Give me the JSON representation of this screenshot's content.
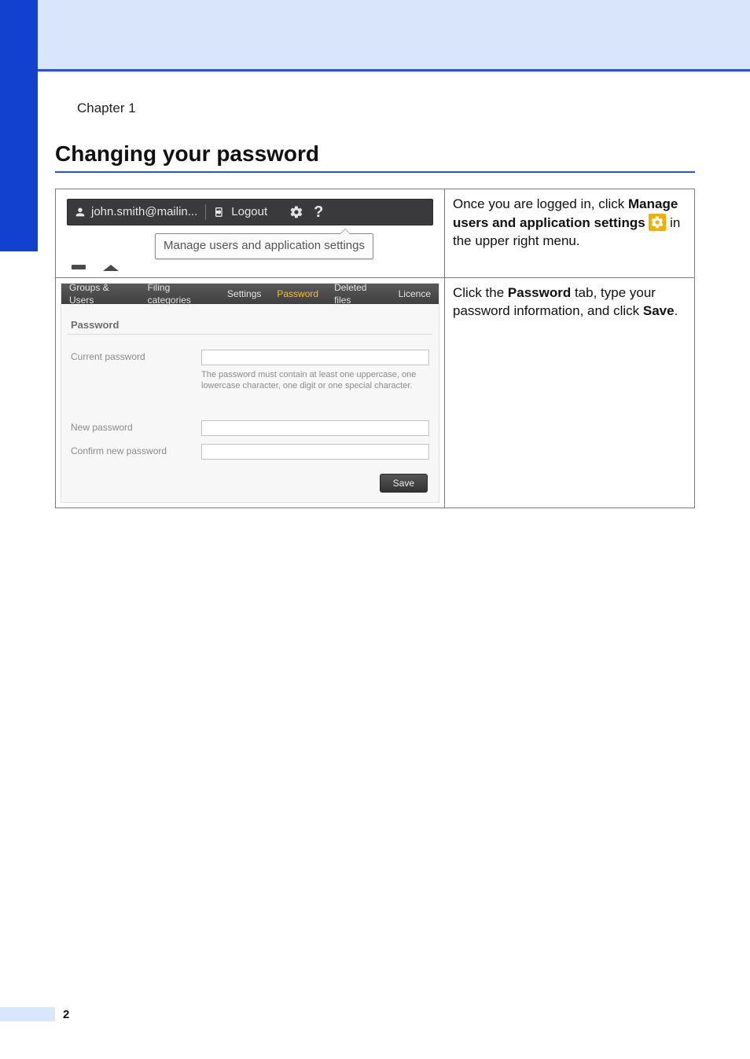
{
  "meta": {
    "chapter_label": "Chapter 1",
    "section_title": "Changing your password",
    "page_number": "2"
  },
  "row1": {
    "user_text": "john.smith@mailin...",
    "logout_text": "Logout",
    "tooltip_text": "Manage users and application settings",
    "instruction": {
      "pre": "Once you are logged in, click ",
      "bold1": "Manage users and application settings",
      "mid": " ",
      "post": " in the upper right menu."
    }
  },
  "row2": {
    "tabs": {
      "groups": "Groups & Users",
      "filing": "Filing categories",
      "settings": "Settings",
      "password": "Password",
      "deleted": "Deleted files",
      "licence": "Licence"
    },
    "panel_title": "Password",
    "labels": {
      "current": "Current password",
      "new": "New password",
      "confirm": "Confirm new password"
    },
    "hint": "The password must contain at least one uppercase, one lowercase character, one digit or one special character.",
    "save_label": "Save",
    "instruction": {
      "t1": "Click the ",
      "b1": "Password",
      "t2": " tab, type your password information, and click ",
      "b2": "Save",
      "t3": "."
    }
  }
}
